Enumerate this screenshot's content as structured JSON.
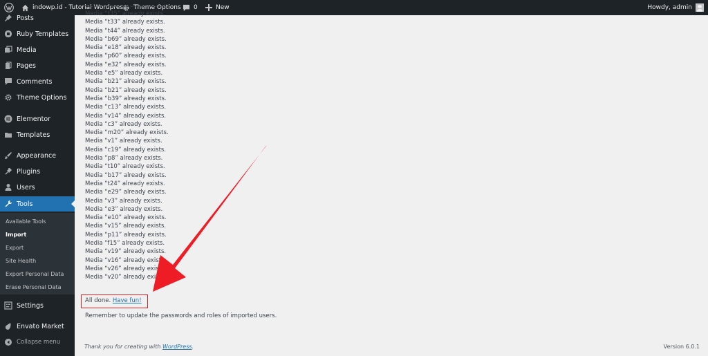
{
  "adminbar": {
    "site_name": "indowp.id - Tutorial Wordpress",
    "theme_options": "Theme Options",
    "comments_count": "0",
    "new_label": "New",
    "howdy": "Howdy, admin"
  },
  "sidebar": {
    "items": [
      {
        "label": "Posts",
        "icon": "pin-icon"
      },
      {
        "label": "Ruby Templates",
        "icon": "ruby-icon"
      },
      {
        "label": "Media",
        "icon": "media-icon"
      },
      {
        "label": "Pages",
        "icon": "pages-icon"
      },
      {
        "label": "Comments",
        "icon": "comment-icon"
      },
      {
        "label": "Theme Options",
        "icon": "gear-icon"
      },
      {
        "label": "Elementor",
        "icon": "elementor-icon"
      },
      {
        "label": "Templates",
        "icon": "folder-icon"
      },
      {
        "label": "Appearance",
        "icon": "brush-icon"
      },
      {
        "label": "Plugins",
        "icon": "plug-icon"
      },
      {
        "label": "Users",
        "icon": "user-icon"
      },
      {
        "label": "Tools",
        "icon": "wrench-icon"
      },
      {
        "label": "Settings",
        "icon": "settings-icon"
      },
      {
        "label": "Envato Market",
        "icon": "leaf-icon"
      },
      {
        "label": "Collapse menu",
        "icon": "collapse-icon"
      }
    ],
    "submenu": [
      "Available Tools",
      "Import",
      "Export",
      "Site Health",
      "Export Personal Data",
      "Erase Personal Data"
    ]
  },
  "log": {
    "partial_top": "Media “t43” already exists.",
    "lines": [
      "Media “t35” already exists.",
      "Media “t33” already exists.",
      "Media “t44” already exists.",
      "Media “b69” already exists.",
      "Media “e18” already exists.",
      "Media “p60” already exists.",
      "Media “e32” already exists.",
      "Media “e5” already exists.",
      "Media “b21” already exists.",
      "Media “b21” already exists.",
      "Media “b39” already exists.",
      "Media “c13” already exists.",
      "Media “v14” already exists.",
      "Media “c3” already exists.",
      "Media “m20” already exists.",
      "Media “v1” already exists.",
      "Media “c19” already exists.",
      "Media “p8” already exists.",
      "Media “t10” already exists.",
      "Media “b17” already exists.",
      "Media “t24” already exists.",
      "Media “e29” already exists.",
      "Media “v3” already exists.",
      "Media “e3” already exists.",
      "Media “e10” already exists.",
      "Media “v15” already exists.",
      "Media “p11” already exists.",
      "Media “f15” already exists.",
      "Media “v19” already exists.",
      "Media “v16” already exists.",
      "Media “v26” already exists.",
      "Media “v20” already exists."
    ]
  },
  "result": {
    "done": "All done.",
    "have_fun": "Have fun!",
    "remember": "Remember to update the passwords and roles of imported users."
  },
  "footer": {
    "thanks": "Thank you for creating with",
    "wordpress": "WordPress",
    "version": "Version 6.0.1"
  },
  "colors": {
    "adminbar_bg": "#1d2327",
    "active_menu": "#2271b1",
    "highlight_red": "#e01e26"
  }
}
